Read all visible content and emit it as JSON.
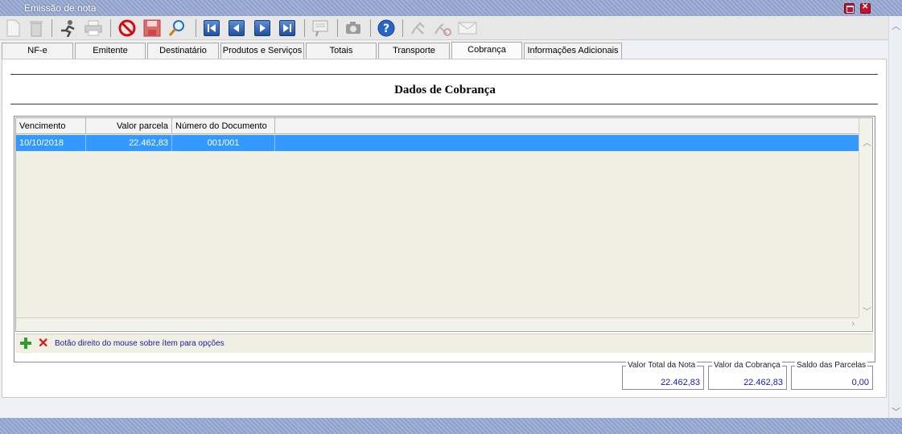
{
  "window": {
    "title": "Emissão de nota"
  },
  "tabs": [
    "NF-e",
    "Emitente",
    "Destinatário",
    "Produtos e Serviços",
    "Totais",
    "Transporte",
    "Cobrança",
    "Informações Adicionais"
  ],
  "section": {
    "title": "Dados de Cobrança"
  },
  "grid": {
    "headers": [
      "Vencimento",
      "Valor parcela",
      "Número do Documento"
    ],
    "rows": [
      {
        "vencimento": "10/10/2018",
        "valor": "22.462,83",
        "documento": "001/001"
      }
    ]
  },
  "footer": {
    "hint": "Botão direito do mouse sobre ítem para opções"
  },
  "totals": {
    "valor_total_nota_label": "Valor Total da Nota",
    "valor_total_nota": "22.462,83",
    "valor_cobranca_label": "Valor da Cobrança",
    "valor_cobranca": "22.462,83",
    "saldo_parcelas_label": "Saldo das Parcelas",
    "saldo_parcelas": "0,00"
  },
  "colors": {
    "selection": "#3399ff",
    "title_bar": "#98a8ce",
    "value_text": "#1a1ab0"
  }
}
